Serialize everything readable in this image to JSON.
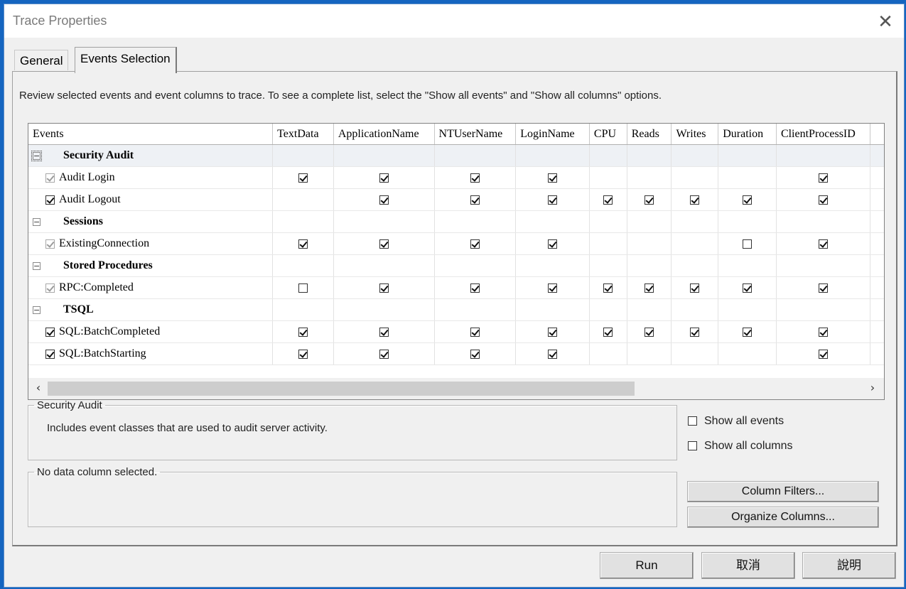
{
  "window": {
    "title": "Trace Properties",
    "close_glyph": "✕"
  },
  "tabs": [
    {
      "label": "General"
    },
    {
      "label": "Events Selection"
    }
  ],
  "intro_text": "Review selected events and event columns to trace. To see a complete list, select the \"Show all events\" and \"Show all columns\" options.",
  "grid": {
    "columns": [
      "Events",
      "TextData",
      "ApplicationName",
      "NTUserName",
      "LoginName",
      "CPU",
      "Reads",
      "Writes",
      "Duration",
      "ClientProcessID"
    ],
    "rows": [
      {
        "type": "category",
        "name": "Security Audit",
        "expander": "−",
        "selected": true
      },
      {
        "type": "event",
        "name": "Audit Login",
        "row_checkbox": "gray",
        "cells": [
          true,
          true,
          true,
          true,
          null,
          null,
          null,
          null,
          true
        ]
      },
      {
        "type": "event",
        "name": "Audit Logout",
        "row_checkbox": "checked",
        "cells": [
          null,
          true,
          true,
          true,
          true,
          true,
          true,
          true,
          true
        ]
      },
      {
        "type": "category",
        "name": "Sessions",
        "expander": "−",
        "selected": false
      },
      {
        "type": "event",
        "name": "ExistingConnection",
        "row_checkbox": "gray",
        "cells": [
          true,
          true,
          true,
          true,
          null,
          null,
          null,
          false,
          true
        ]
      },
      {
        "type": "category",
        "name": "Stored Procedures",
        "expander": "−",
        "selected": false
      },
      {
        "type": "event",
        "name": "RPC:Completed",
        "row_checkbox": "gray",
        "cells": [
          false,
          true,
          true,
          true,
          true,
          true,
          true,
          true,
          true
        ]
      },
      {
        "type": "category",
        "name": "TSQL",
        "expander": "−",
        "selected": false
      },
      {
        "type": "event",
        "name": "SQL:BatchCompleted",
        "row_checkbox": "checked",
        "cells": [
          true,
          true,
          true,
          true,
          true,
          true,
          true,
          true,
          true
        ]
      },
      {
        "type": "event",
        "name": "SQL:BatchStarting",
        "row_checkbox": "checked",
        "cells": [
          true,
          true,
          true,
          true,
          null,
          null,
          null,
          null,
          true
        ]
      }
    ],
    "scroll_left": "‹",
    "scroll_right": "›"
  },
  "description_box": {
    "title": "Security Audit",
    "text": "Includes event classes that are used to audit server activity."
  },
  "column_box": {
    "title": "No data column selected."
  },
  "options": {
    "show_all_events": {
      "label": "Show all events",
      "checked": false
    },
    "show_all_columns": {
      "label": "Show all columns",
      "checked": false
    }
  },
  "buttons": {
    "column_filters": "Column Filters...",
    "organize_columns": "Organize Columns...",
    "run": "Run",
    "cancel": "取消",
    "help": "說明"
  }
}
